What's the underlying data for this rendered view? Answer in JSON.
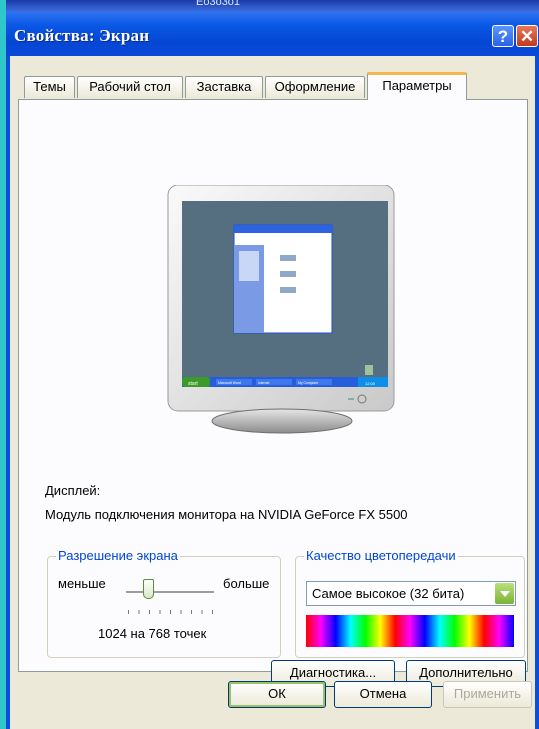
{
  "window": {
    "caption_strip": "Eo3o3o1",
    "title": "Свойства: Экран",
    "help_label": "?",
    "close_label": "✕"
  },
  "tabs": [
    {
      "label": "Темы"
    },
    {
      "label": "Рабочий стол"
    },
    {
      "label": "Заставка"
    },
    {
      "label": "Оформление"
    },
    {
      "label": "Параметры",
      "active": true
    }
  ],
  "monitor_preview": {
    "start_label": "start",
    "taskbar_items": [
      "Microsoft Word",
      "Internet",
      "My Computer"
    ],
    "clock": "12:00"
  },
  "display": {
    "label": "Дисплей:",
    "value": "Модуль подключения монитора на NVIDIA GeForce FX 5500"
  },
  "resolution": {
    "group_title": "Разрешение экрана",
    "less_label": "меньше",
    "more_label": "больше",
    "value_text": "1024 на 768 точек",
    "slider_fraction": 0.25
  },
  "color_quality": {
    "group_title": "Качество цветопередачи",
    "selected": "Самое высокое (32 бита)"
  },
  "buttons": {
    "diagnostics": "Диагностика...",
    "advanced": "Дополнительно",
    "ok": "ОК",
    "cancel": "Отмена",
    "apply": "Применить"
  },
  "colors": {
    "titlebar": "#0a4fd8",
    "panel": "#fcfcfe",
    "dialog_bg": "#ece9d8",
    "group_title": "#0046d5",
    "desktop_preview": "#566f80"
  }
}
